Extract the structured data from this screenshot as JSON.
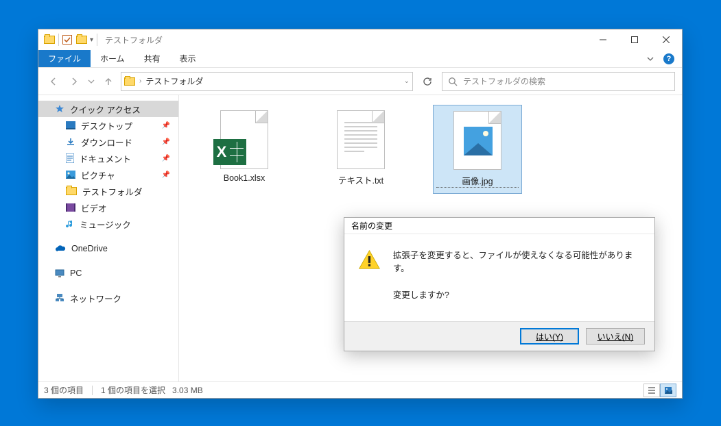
{
  "titlebar": {
    "title": "テストフォルダ"
  },
  "ribbon": {
    "file": "ファイル",
    "tabs": [
      "ホーム",
      "共有",
      "表示"
    ]
  },
  "addressbar": {
    "folder": "テストフォルダ"
  },
  "search": {
    "placeholder": "テストフォルダの検索"
  },
  "sidebar": {
    "quick_access": "クイック アクセス",
    "desktop": "デスクトップ",
    "downloads": "ダウンロード",
    "documents": "ドキュメント",
    "pictures": "ピクチャ",
    "test_folder": "テストフォルダ",
    "videos": "ビデオ",
    "music": "ミュージック",
    "onedrive": "OneDrive",
    "pc": "PC",
    "network": "ネットワーク"
  },
  "files": [
    {
      "name": "Book1.xlsx"
    },
    {
      "name": "テキスト.txt"
    },
    {
      "name": "画像.jpg"
    }
  ],
  "dialog": {
    "title": "名前の変更",
    "line1": "拡張子を変更すると、ファイルが使えなくなる可能性があります。",
    "line2": "変更しますか?",
    "yes": "はい(Y)",
    "no": "いいえ(N)"
  },
  "status": {
    "count": "3 個の項目",
    "selected": "1 個の項目を選択",
    "size": "3.03 MB"
  }
}
